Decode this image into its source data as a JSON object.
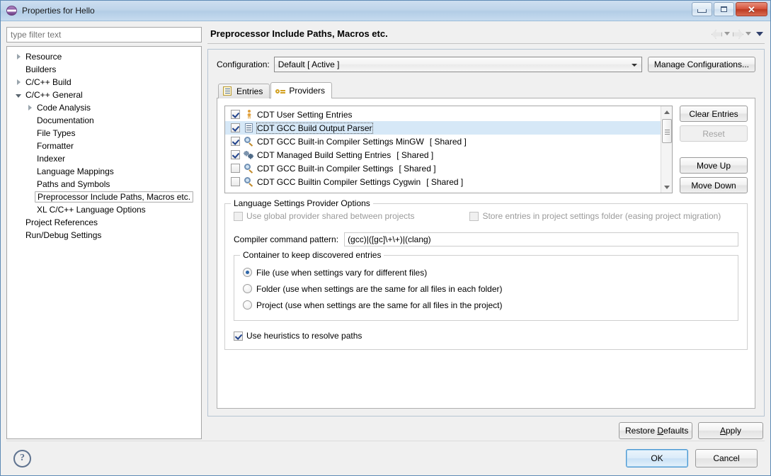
{
  "window": {
    "title": "Properties for Hello",
    "icon": "eclipse-sphere-icon",
    "minimize_label": "",
    "maximize_label": "",
    "close_label": "✕"
  },
  "sidebar": {
    "filter_placeholder": "type filter text",
    "filter_value": "",
    "items": [
      {
        "label": "Resource",
        "indent": 1,
        "twisty": "collapsed",
        "selected": false
      },
      {
        "label": "Builders",
        "indent": 1,
        "twisty": "none",
        "selected": false
      },
      {
        "label": "C/C++ Build",
        "indent": 1,
        "twisty": "collapsed",
        "selected": false
      },
      {
        "label": "C/C++ General",
        "indent": 1,
        "twisty": "expanded",
        "selected": false
      },
      {
        "label": "Code Analysis",
        "indent": 2,
        "twisty": "collapsed",
        "selected": false
      },
      {
        "label": "Documentation",
        "indent": 2,
        "twisty": "none",
        "selected": false
      },
      {
        "label": "File Types",
        "indent": 2,
        "twisty": "none",
        "selected": false
      },
      {
        "label": "Formatter",
        "indent": 2,
        "twisty": "none",
        "selected": false
      },
      {
        "label": "Indexer",
        "indent": 2,
        "twisty": "none",
        "selected": false
      },
      {
        "label": "Language Mappings",
        "indent": 2,
        "twisty": "none",
        "selected": false
      },
      {
        "label": "Paths and Symbols",
        "indent": 2,
        "twisty": "none",
        "selected": false
      },
      {
        "label": "Preprocessor Include Paths, Macros etc.",
        "indent": 2,
        "twisty": "none",
        "selected": true
      },
      {
        "label": "XL C/C++ Language Options",
        "indent": 2,
        "twisty": "none",
        "selected": false
      },
      {
        "label": "Project References",
        "indent": 1,
        "twisty": "none",
        "selected": false
      },
      {
        "label": "Run/Debug Settings",
        "indent": 1,
        "twisty": "none",
        "selected": false
      }
    ]
  },
  "page": {
    "title": "Preprocessor Include Paths, Macros etc.",
    "nav": {
      "back_icon": "back-arrow-icon",
      "back_menu_icon": "chevron-down-icon",
      "forward_icon": "forward-arrow-icon",
      "forward_menu_icon": "chevron-down-icon",
      "menu_icon": "chevron-down-icon"
    }
  },
  "configuration": {
    "label": "Configuration:",
    "selected": "Default  [ Active ]",
    "manage_button": "Manage Configurations..."
  },
  "tabs": [
    {
      "label": "Entries",
      "icon": "entries-icon",
      "active": false
    },
    {
      "label": "Providers",
      "icon": "providers-icon",
      "active": true
    }
  ],
  "providers": {
    "rows": [
      {
        "name": "CDT User Setting Entries",
        "shared": "",
        "checked": true,
        "enabled": true,
        "icon": "person-icon",
        "selected": false
      },
      {
        "name": "CDT GCC Build Output Parser",
        "shared": "",
        "checked": true,
        "enabled": true,
        "icon": "document-icon",
        "selected": true
      },
      {
        "name": "CDT GCC Built-in Compiler Settings MinGW",
        "shared": "[ Shared ]",
        "checked": true,
        "enabled": true,
        "icon": "magnifier-icon",
        "selected": false
      },
      {
        "name": "CDT Managed Build Setting Entries",
        "shared": "[ Shared ]",
        "checked": true,
        "enabled": true,
        "icon": "gears-icon",
        "selected": false
      },
      {
        "name": "CDT GCC Built-in Compiler Settings",
        "shared": "[ Shared ]",
        "checked": false,
        "enabled": true,
        "icon": "magnifier-icon",
        "selected": false
      },
      {
        "name": "CDT GCC Builtin Compiler Settings Cygwin",
        "shared": "[ Shared ]",
        "checked": false,
        "enabled": true,
        "icon": "magnifier-icon",
        "selected": false
      }
    ],
    "buttons": {
      "clear_entries": "Clear Entries",
      "reset": "Reset",
      "reset_disabled": true,
      "move_up": "Move Up",
      "move_down": "Move Down"
    },
    "scrollbar": {
      "up_icon": "scroll-up-icon",
      "down_icon": "scroll-down-icon"
    }
  },
  "provider_options": {
    "group_title": "Language Settings Provider Options",
    "use_global": {
      "label": "Use global provider shared between projects",
      "checked": false,
      "enabled": false
    },
    "store_entries": {
      "label": "Store entries in project settings folder (easing project migration)",
      "checked": false,
      "enabled": false
    },
    "compiler_pattern": {
      "label": "Compiler command pattern:",
      "value": "(gcc)|([gc]\\+\\+)|(clang)"
    },
    "container": {
      "group_title": "Container to keep discovered entries",
      "options": [
        {
          "label": "File (use when settings vary for different files)",
          "selected": true
        },
        {
          "label": "Folder (use when settings are the same for all files in each folder)",
          "selected": false
        },
        {
          "label": "Project (use when settings are the same for all files in the project)",
          "selected": false
        }
      ]
    },
    "heuristics": {
      "label": "Use heuristics to resolve paths",
      "checked": true
    }
  },
  "footer": {
    "restore_defaults": "Restore Defaults",
    "restore_mnemonic": "D",
    "apply": "Apply",
    "apply_mnemonic": "A",
    "help_icon": "help-question-icon",
    "ok": "OK",
    "cancel": "Cancel"
  }
}
